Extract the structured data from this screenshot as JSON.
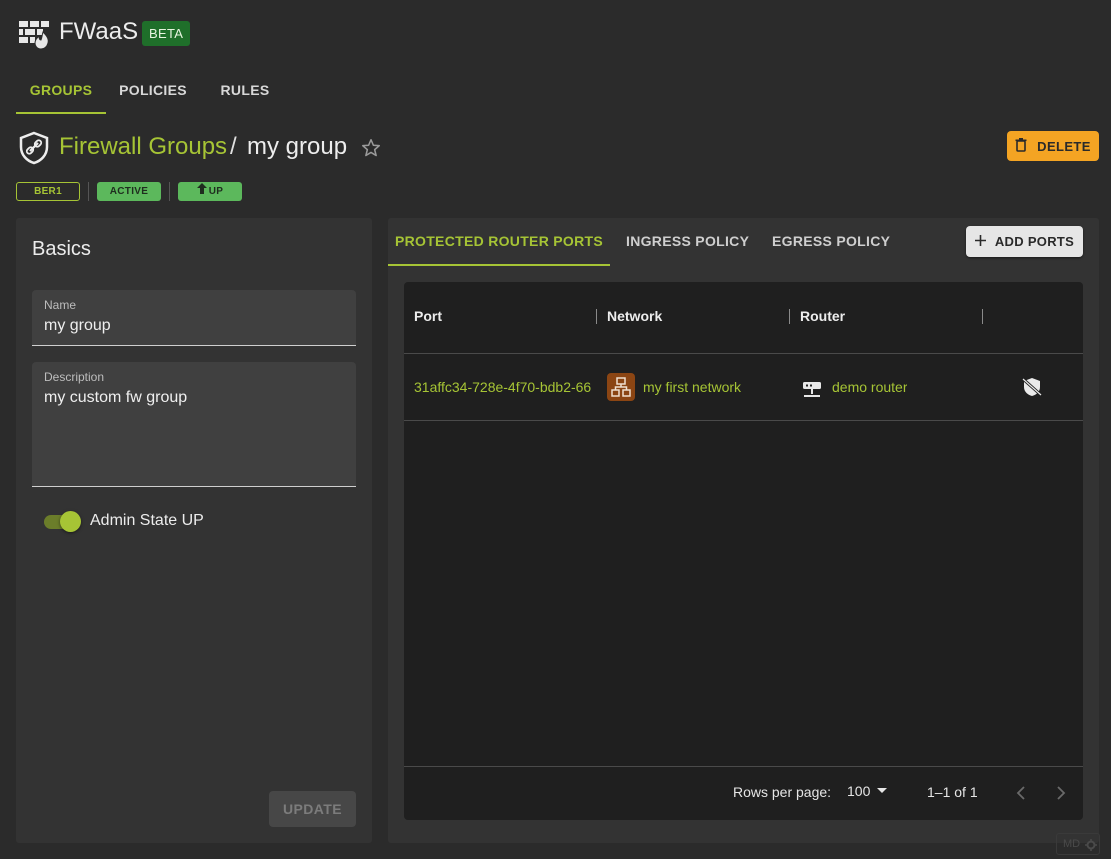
{
  "app": {
    "title": "FWaaS",
    "beta": "BETA"
  },
  "nav": {
    "tabs": [
      {
        "label": "GROUPS",
        "active": true
      },
      {
        "label": "POLICIES",
        "active": false
      },
      {
        "label": "RULES",
        "active": false
      }
    ]
  },
  "breadcrumb": {
    "parent": "Firewall Groups",
    "separator": "/",
    "current": "my group"
  },
  "actions": {
    "delete_label": "DELETE"
  },
  "badges": {
    "region": "BER1",
    "status": "ACTIVE",
    "admin": "UP"
  },
  "basics": {
    "title": "Basics",
    "name_label": "Name",
    "name_value": "my group",
    "description_label": "Description",
    "description_value": "my custom fw group",
    "admin_state_label": "Admin State UP",
    "admin_state_on": true,
    "update_label": "UPDATE"
  },
  "detail_tabs": [
    {
      "label": "PROTECTED ROUTER PORTS",
      "active": true
    },
    {
      "label": "INGRESS POLICY",
      "active": false
    },
    {
      "label": "EGRESS POLICY",
      "active": false
    }
  ],
  "add_ports_label": "ADD PORTS",
  "table": {
    "columns": [
      "Port",
      "Network",
      "Router"
    ],
    "rows": [
      {
        "port": "31affc34-728e-4f70-bdb2-66",
        "network": "my first network",
        "router": "demo router"
      }
    ],
    "rows_per_page_label": "Rows per page:",
    "rows_per_page": "100",
    "range": "1–1 of 1"
  },
  "md_badge": "MD",
  "colors": {
    "accent": "#a6c435",
    "warning": "#f4a423",
    "success": "#5cb85c",
    "beta": "#1f6f2a",
    "network_icon_bg": "#8b4513"
  },
  "icons": [
    "firewall-logo-icon",
    "shield-link-icon",
    "star-outline-icon",
    "trash-icon",
    "arrow-up-icon",
    "plus-icon",
    "network-icon",
    "router-icon",
    "shield-off-icon",
    "caret-down-icon",
    "chevron-left-icon",
    "chevron-right-icon",
    "gear-icon"
  ]
}
